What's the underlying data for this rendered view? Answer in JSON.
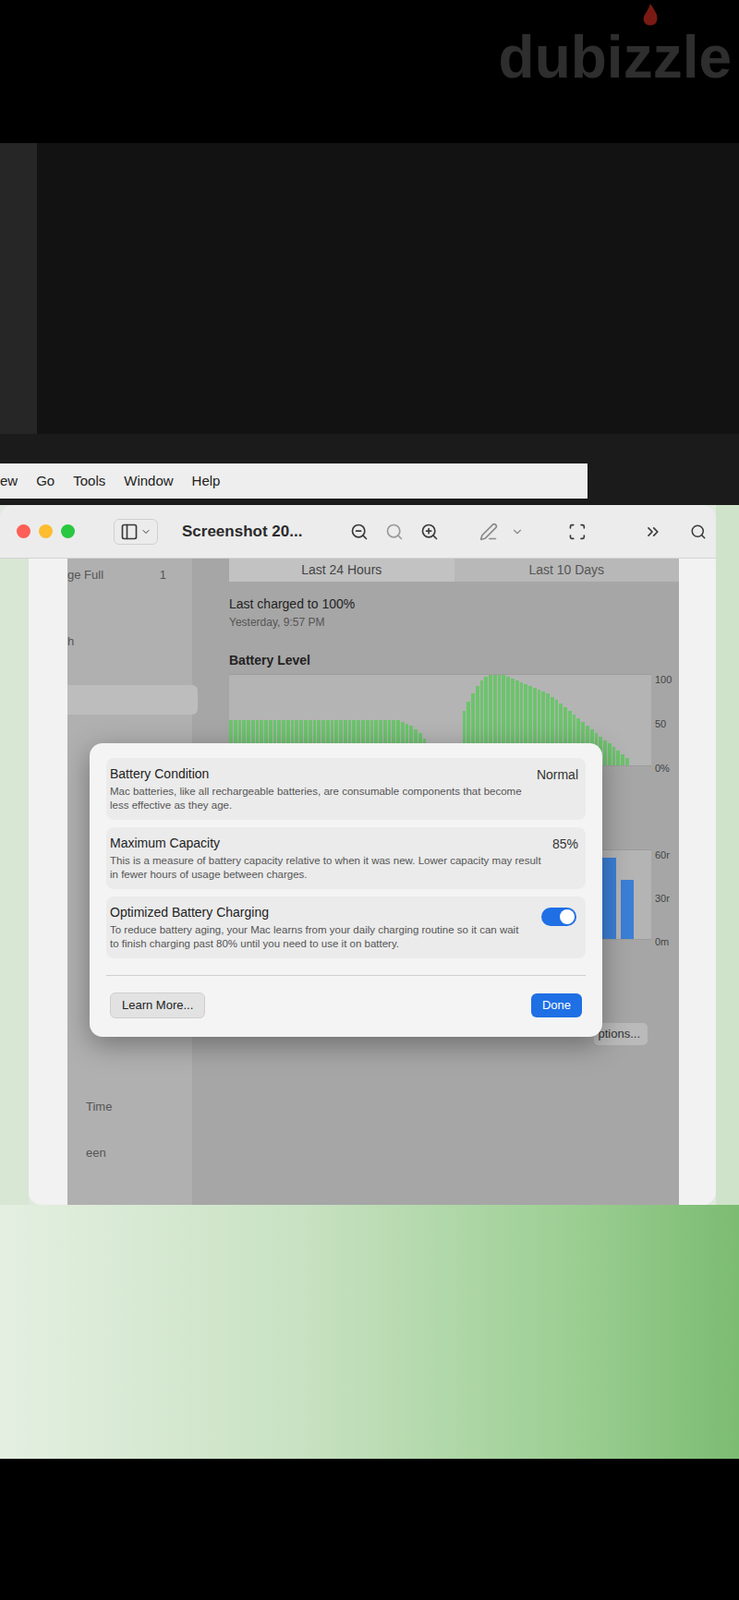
{
  "watermark": "dubizzle",
  "menubar": [
    "ew",
    "Go",
    "Tools",
    "Window",
    "Help"
  ],
  "window": {
    "title": "Screenshot 20..."
  },
  "screenshot": {
    "sidebar": [
      {
        "label": "ge Full",
        "count": "1"
      },
      {
        "label": "h",
        "count": ""
      },
      {
        "label": "Time",
        "count": ""
      },
      {
        "label": "een",
        "count": ""
      }
    ],
    "tabs": [
      {
        "label": "Last 24 Hours",
        "selected": true
      },
      {
        "label": "Last 10 Days",
        "selected": false
      }
    ],
    "last_charged": "Last charged to 100%",
    "last_charged_time": "Yesterday, 9:57 PM",
    "battery_chart": {
      "title": "Battery Level",
      "ticks": [
        "100",
        "50",
        "0%"
      ],
      "values": [
        50,
        50,
        50,
        50,
        50,
        50,
        50,
        50,
        50,
        50,
        50,
        50,
        50,
        50,
        50,
        50,
        50,
        50,
        50,
        50,
        50,
        50,
        50,
        50,
        50,
        50,
        50,
        50,
        50,
        50,
        50,
        50,
        50,
        50,
        50,
        50,
        50,
        50,
        50,
        48,
        46,
        44,
        40,
        36,
        30,
        0,
        0,
        0,
        0,
        0,
        0,
        0,
        0,
        60,
        70,
        80,
        88,
        94,
        98,
        100,
        100,
        100,
        100,
        98,
        96,
        94,
        92,
        90,
        88,
        86,
        84,
        82,
        80,
        76,
        72,
        68,
        64,
        60,
        56,
        52,
        48,
        44,
        40,
        36,
        32,
        28,
        24,
        20,
        16,
        12,
        8,
        0,
        0,
        0,
        0,
        0
      ]
    },
    "usage_chart": {
      "ticks": [
        "60r",
        "30r",
        "0m"
      ],
      "values": [
        0,
        0,
        0,
        0,
        0,
        0,
        0,
        0,
        0,
        0,
        0,
        0,
        0,
        0,
        0,
        0,
        0,
        0,
        0,
        0,
        0,
        55,
        40,
        0
      ]
    },
    "options_button": "ptions..."
  },
  "dialog": {
    "rows": [
      {
        "kind": "value",
        "title": "Battery Condition",
        "description": "Mac batteries, like all rechargeable batteries, are consumable components that become less effective as they age.",
        "value": "Normal"
      },
      {
        "kind": "value",
        "title": "Maximum Capacity",
        "description": "This is a measure of battery capacity relative to when it was new. Lower capacity may result in fewer hours of usage between charges.",
        "value": "85%"
      },
      {
        "kind": "toggle",
        "title": "Optimized Battery Charging",
        "description": "To reduce battery aging, your Mac learns from your daily charging routine so it can wait to finish charging past 80% until you need to use it on battery.",
        "on": true
      }
    ],
    "buttons": [
      {
        "label": "Learn More...",
        "primary": false
      },
      {
        "label": "Done",
        "primary": true
      }
    ]
  }
}
